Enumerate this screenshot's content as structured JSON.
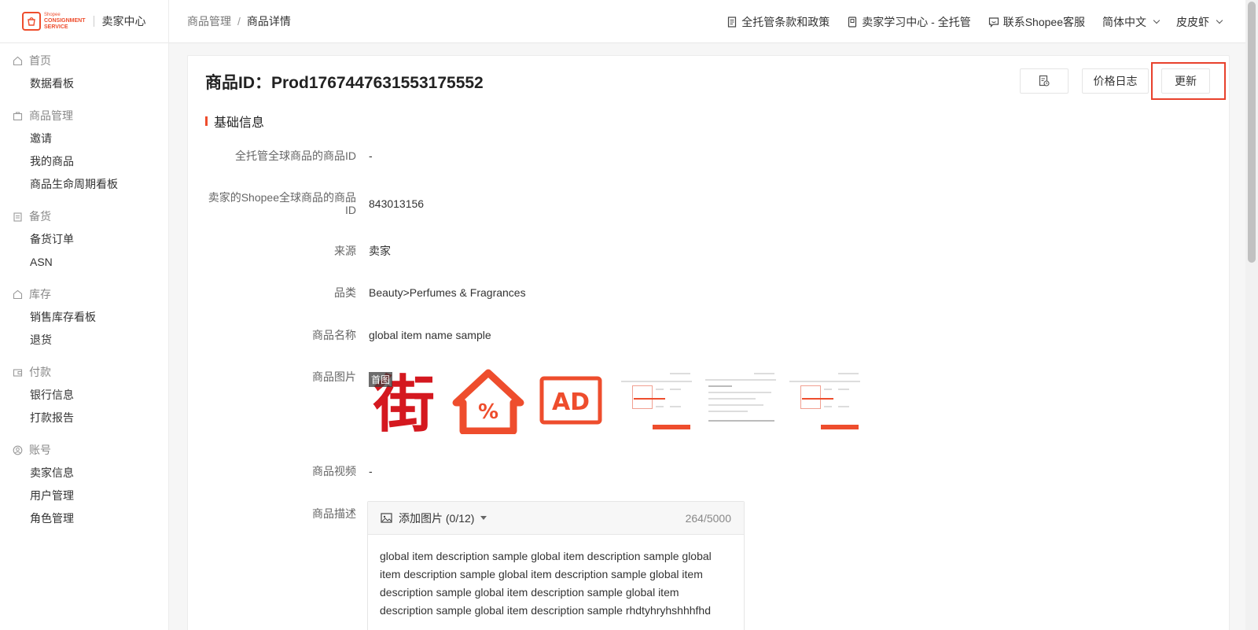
{
  "brand": {
    "logo_top": "Shopee",
    "logo_line1": "CONSIGNMENT",
    "logo_line2": "SERVICE",
    "title": "卖家中心"
  },
  "breadcrumb": {
    "parent": "商品管理",
    "separator": "/",
    "current": "商品详情"
  },
  "header": {
    "links": [
      {
        "label": "全托管条款和政策",
        "icon": "document-icon"
      },
      {
        "label": "卖家学习中心 - 全托管",
        "icon": "book-icon"
      },
      {
        "label": "联系Shopee客服",
        "icon": "chat-icon"
      }
    ],
    "language": "简体中文",
    "user": "皮皮虾"
  },
  "sidebar": {
    "groups": [
      {
        "title": "首页",
        "icon": "home-icon",
        "items": [
          "数据看板"
        ]
      },
      {
        "title": "商品管理",
        "icon": "bag-icon",
        "items": [
          "邀请",
          "我的商品",
          "商品生命周期看板"
        ]
      },
      {
        "title": "备货",
        "icon": "clipboard-icon",
        "items": [
          "备货订单",
          "ASN"
        ]
      },
      {
        "title": "库存",
        "icon": "warehouse-icon",
        "items": [
          "销售库存看板",
          "退货"
        ]
      },
      {
        "title": "付款",
        "icon": "wallet-icon",
        "items": [
          "银行信息",
          "打款报告"
        ]
      },
      {
        "title": "账号",
        "icon": "user-icon",
        "items": [
          "卖家信息",
          "用户管理",
          "角色管理"
        ]
      }
    ]
  },
  "product": {
    "title": "商品ID：Prod1767447631553175552",
    "buttons": {
      "price_log": "价格日志",
      "update": "更新"
    },
    "section": "基础信息",
    "fields": {
      "global_id_label": "全托管全球商品的商品ID",
      "global_id_value": "-",
      "seller_id_label": "卖家的Shopee全球商品的商品ID",
      "seller_id_value": "843013156",
      "source_label": "来源",
      "source_value": "卖家",
      "category_label": "品类",
      "category_value": "Beauty>Perfumes & Fragrances",
      "name_label": "商品名称",
      "name_value": "global item name sample",
      "images_label": "商品图片",
      "cover_badge": "首图",
      "video_label": "商品视频",
      "video_value": "-",
      "desc_label": "商品描述"
    },
    "images": [
      {
        "icon": "street-character-icon",
        "text": "街",
        "color": "#d4181f"
      },
      {
        "icon": "discount-house-icon",
        "text": "%",
        "color": "#ee4d2d"
      },
      {
        "icon": "ad-icon",
        "text": "AD",
        "color": "#ee4d2d"
      },
      {
        "icon": "screenshot-thumbnail"
      },
      {
        "icon": "screenshot-thumbnail"
      },
      {
        "icon": "screenshot-thumbnail"
      }
    ],
    "editor": {
      "add_image": "添加图片 (0/12)",
      "counter": "264/5000",
      "text": "global item description sample global item description sample global item description sample global item description sample global item description sample global item description sample global item description sample global item description sample rhdtyhryhshhhfhd"
    }
  },
  "colors": {
    "accent": "#ee4d2d",
    "highlight": "#e8412c"
  }
}
